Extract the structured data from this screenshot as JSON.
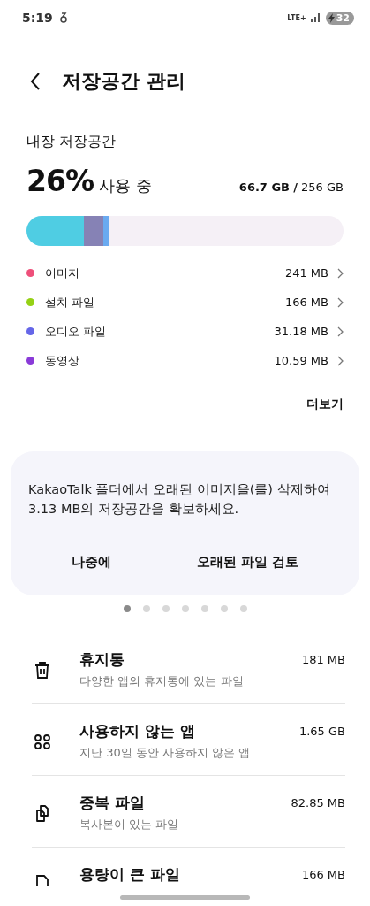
{
  "status_bar": {
    "time": "5:19",
    "network": "LTE+",
    "battery": "32"
  },
  "header": {
    "title": "저장공간 관리"
  },
  "storage": {
    "title": "내장 저장공간",
    "percent": "26%",
    "used_label": "사용 중",
    "used": "66.7 GB",
    "separator": "/",
    "total": "256 GB",
    "bar": [
      {
        "color": "#4fcde3"
      },
      {
        "color": "#8682b5"
      },
      {
        "color": "#6aaaf0"
      }
    ],
    "categories": [
      {
        "name": "이미지",
        "size": "241 MB",
        "color": "#ee4f7a"
      },
      {
        "name": "설치 파일",
        "size": "166 MB",
        "color": "#95d115"
      },
      {
        "name": "오디오 파일",
        "size": "31.18 MB",
        "color": "#6566e8"
      },
      {
        "name": "동영상",
        "size": "10.59 MB",
        "color": "#8a3ad8"
      }
    ],
    "more": "더보기"
  },
  "suggestion": {
    "message": "KakaoTalk 폴더에서 오래된 이미지을(를) 삭제하여 3.13 MB의 저장공간을 확보하세요.",
    "buttons": [
      "나중에",
      "오래된 파일 검토"
    ]
  },
  "pager": [
    {
      "selected": true
    },
    {
      "selected": false
    },
    {
      "selected": false
    },
    {
      "selected": false
    },
    {
      "selected": false
    },
    {
      "selected": false
    },
    {
      "selected": false
    }
  ],
  "tools": [
    {
      "kind": "trash",
      "title": "휴지통",
      "subtitle": "다양한 앱의 휴지통에 있는 파일",
      "size": "181 MB"
    },
    {
      "kind": "apps",
      "title": "사용하지 않는 앱",
      "subtitle": "지난 30일 동안 사용하지 않은 앱",
      "size": "1.65 GB"
    },
    {
      "kind": "duplicate",
      "title": "중복 파일",
      "subtitle": "복사본이 있는 파일",
      "size": "82.85 MB"
    },
    {
      "kind": "large",
      "title": "용량이 큰 파일",
      "size": "166 MB"
    }
  ]
}
